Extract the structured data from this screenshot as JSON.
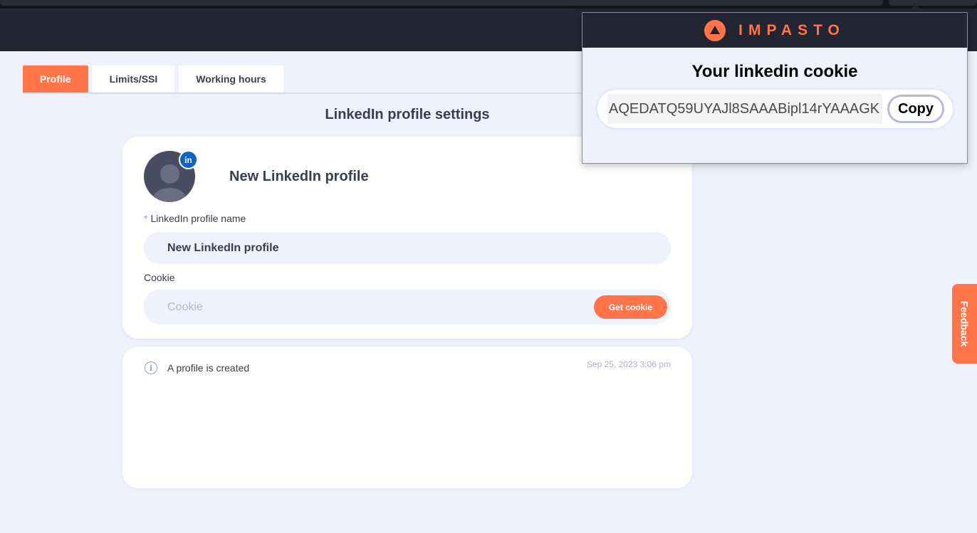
{
  "popup": {
    "brand": "IMPASTO",
    "title": "Your linkedin cookie",
    "cookie_value": "AQEDATQ59UYAJl8SAAABipl14rYAAAGK",
    "copy_label": "Copy"
  },
  "tabs": [
    {
      "label": "Profile",
      "active": true
    },
    {
      "label": "Limits/SSI",
      "active": false
    },
    {
      "label": "Working hours",
      "active": false
    }
  ],
  "page": {
    "title": "LinkedIn profile settings"
  },
  "profile_card": {
    "badge": "in",
    "heading": "New LinkedIn profile",
    "name_label": "LinkedIn profile name",
    "name_required_mark": "*",
    "name_value": "New LinkedIn profile",
    "cookie_label": "Cookie",
    "cookie_placeholder": "Cookie",
    "get_cookie_label": "Get cookie"
  },
  "log": {
    "info_glyph": "i",
    "text": "A profile is created",
    "timestamp": "Sep 25, 2023 3:06 pm"
  },
  "feedback": {
    "label": "Feedback"
  },
  "colors": {
    "accent": "#ff7448",
    "header_bg": "#232533",
    "page_bg": "#eff1fc",
    "linkedin": "#0a66c2"
  },
  "icons": {
    "logo": "impasto-logo-icon",
    "linkedin": "linkedin-icon",
    "info": "info-icon",
    "avatar": "user-avatar-icon"
  }
}
